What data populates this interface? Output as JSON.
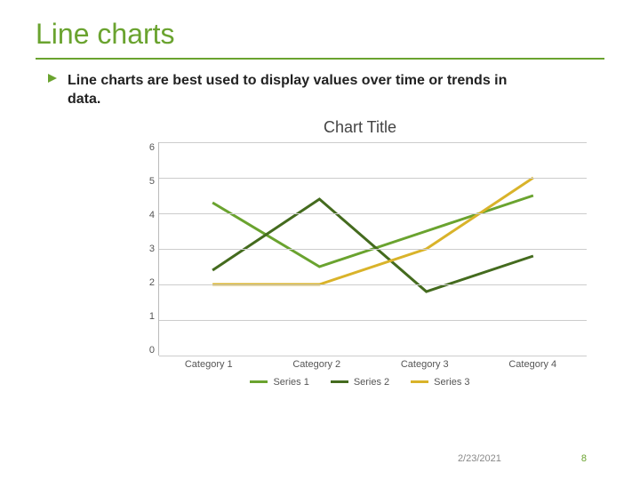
{
  "title": "Line charts",
  "bullet": "Line charts are best used to display values over time or trends in data.",
  "footer": {
    "date": "2/23/2021",
    "page": "8"
  },
  "chart_data": {
    "type": "line",
    "title": "Chart Title",
    "xlabel": "",
    "ylabel": "",
    "categories": [
      "Category 1",
      "Category 2",
      "Category 3",
      "Category 4"
    ],
    "y_ticks": [
      0,
      1,
      2,
      3,
      4,
      5,
      6
    ],
    "ylim": [
      0,
      6
    ],
    "series": [
      {
        "name": "Series 1",
        "color": "#6aa32f",
        "values": [
          4.3,
          2.5,
          3.5,
          4.5
        ]
      },
      {
        "name": "Series 2",
        "color": "#446b1e",
        "values": [
          2.4,
          4.4,
          1.8,
          2.8
        ]
      },
      {
        "name": "Series 3",
        "color": "#d9b32a",
        "values": [
          2.0,
          2.0,
          3.0,
          5.0
        ]
      }
    ],
    "legend_position": "bottom",
    "grid": true
  }
}
